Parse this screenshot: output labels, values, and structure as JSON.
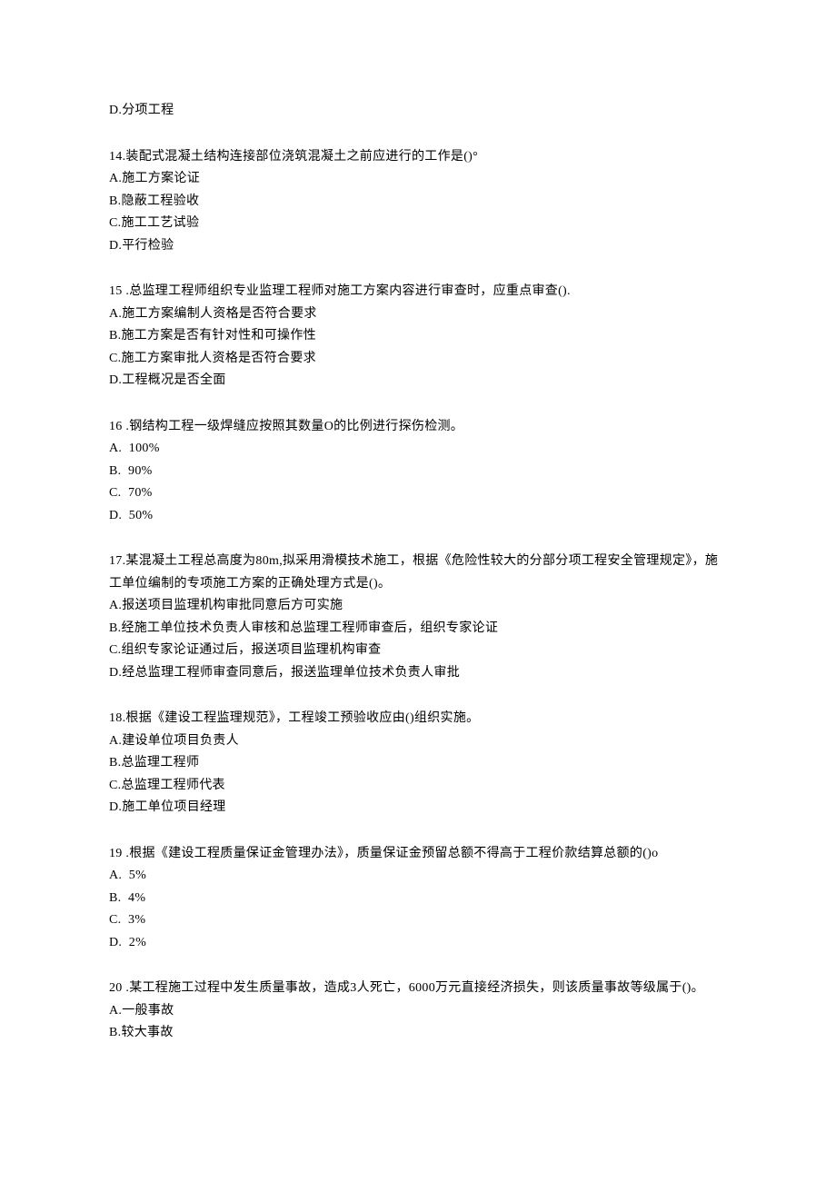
{
  "orphan_option": "D.分项工程",
  "questions": [
    {
      "stem": "14.装配式混凝土结构连接部位浇筑混凝土之前应进行的工作是()°",
      "options": [
        "A.施工方案论证",
        "B.隐蔽工程验收",
        "C.施工工艺试验",
        "D.平行检验"
      ]
    },
    {
      "stem": "15 .总监理工程师组织专业监理工程师对施工方案内容进行审查时，应重点审查().",
      "options": [
        "A.施工方案编制人资格是否符合要求",
        "B.施工方案是否有针对性和可操作性",
        "C.施工方案审批人资格是否符合要求",
        "D.工程概况是否全面"
      ]
    },
    {
      "stem": "16 .钢结构工程一级焊缝应按照其数量O的比例进行探伤检测。",
      "options": [
        "A.  100%",
        "B.  90%",
        "C.  70%",
        "D.  50%"
      ]
    },
    {
      "stem": "17.某混凝土工程总高度为80m,拟采用滑模技术施工，根据《危险性较大的分部分项工程安全管理规定》，施工单位编制的专项施工方案的正确处理方式是()。",
      "options": [
        "A.报送项目监理机构审批同意后方可实施",
        "B.经施工单位技术负责人审核和总监理工程师审查后，组织专家论证",
        "C.组织专家论证通过后，报送项目监理机构审查",
        "D.经总监理工程师审查同意后，报送监理单位技术负责人审批"
      ]
    },
    {
      "stem": "18.根据《建设工程监理规范》，工程竣工预验收应由()组织实施。",
      "options": [
        "A.建设单位项目负责人",
        "B.总监理工程师",
        "C.总监理工程师代表",
        "D.施工单位项目经理"
      ]
    },
    {
      "stem": "19 .根据《建设工程质量保证金管理办法》，质量保证金预留总额不得高于工程价款结算总额的()o",
      "options": [
        "A.  5%",
        "B.  4%",
        "C.  3%",
        "D.  2%"
      ]
    },
    {
      "stem": "20 .某工程施工过程中发生质量事故，造成3人死亡，6000万元直接经济损失，则该质量事故等级属于()。",
      "options": [
        "A.一般事故",
        "B.较大事故"
      ]
    }
  ]
}
